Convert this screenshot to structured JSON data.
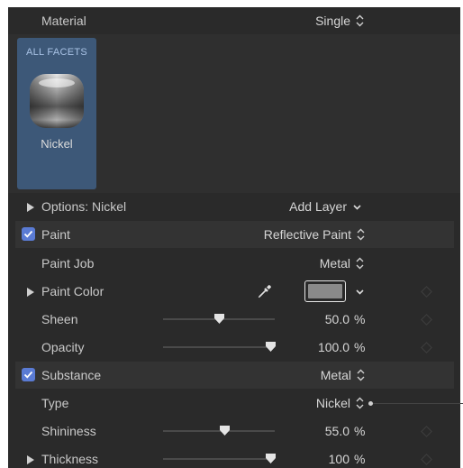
{
  "header": {
    "label": "Material",
    "value": "Single"
  },
  "facets": {
    "tile_label": "ALL FACETS",
    "material_name": "Nickel"
  },
  "options": {
    "label": "Options: Nickel",
    "add_layer": "Add Layer"
  },
  "paint": {
    "label": "Paint",
    "value": "Reflective Paint",
    "paint_job": {
      "label": "Paint Job",
      "value": "Metal"
    },
    "paint_color": {
      "label": "Paint Color",
      "swatch_color": "#8a8a8a"
    },
    "sheen": {
      "label": "Sheen",
      "value": "50.0",
      "unit": "%",
      "fraction": 0.5
    },
    "opacity": {
      "label": "Opacity",
      "value": "100.0",
      "unit": "%",
      "fraction": 1.0
    }
  },
  "substance": {
    "label": "Substance",
    "value": "Metal",
    "type": {
      "label": "Type",
      "value": "Nickel"
    },
    "shininess": {
      "label": "Shininess",
      "value": "55.0",
      "unit": "%",
      "fraction": 0.55
    },
    "thickness": {
      "label": "Thickness",
      "value": "100",
      "unit": "%",
      "fraction": 1.0
    }
  },
  "colors": {
    "panel": "#2a2a2a",
    "accent": "#5a7bd4",
    "tile": "#3d5878"
  }
}
